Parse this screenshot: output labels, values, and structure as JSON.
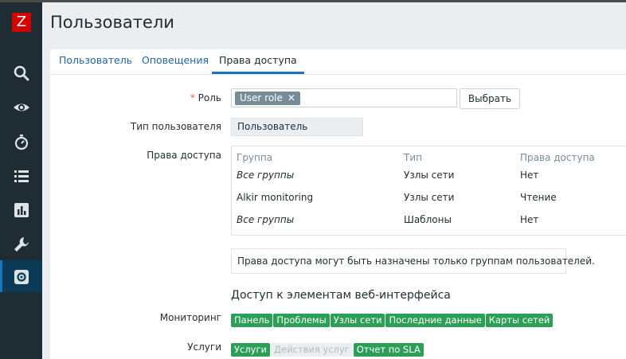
{
  "app": {
    "logo_letter": "Z"
  },
  "page": {
    "title": "Пользователи"
  },
  "sidebar": {
    "items": [
      {
        "icon": "search-icon"
      },
      {
        "icon": "eye-icon"
      },
      {
        "icon": "stopwatch-icon"
      },
      {
        "icon": "list-icon"
      },
      {
        "icon": "bar-chart-icon"
      },
      {
        "icon": "wrench-icon"
      },
      {
        "icon": "gear-icon",
        "active": true
      }
    ]
  },
  "tabs": [
    {
      "label": "Пользователь"
    },
    {
      "label": "Оповещения"
    },
    {
      "label": "Права доступа",
      "active": true
    }
  ],
  "form": {
    "role_label": "Роль",
    "role_required_mark": "*",
    "role_value": "User role",
    "role_remove": "✕",
    "select_button": "Выбрать",
    "user_type_label": "Тип пользователя",
    "user_type_value": "Пользователь",
    "permissions_label": "Права доступа",
    "permissions_table": {
      "headers": [
        "Группа",
        "Тип",
        "Права доступа"
      ],
      "rows": [
        {
          "group": "Все группы",
          "type": "Узлы сети",
          "access": "Нет",
          "italic": true
        },
        {
          "group": "Alkir monitoring",
          "type": "Узлы сети",
          "access": "Чтение",
          "italic": false
        },
        {
          "group": "Все группы",
          "type": "Шаблоны",
          "access": "Нет",
          "italic": true
        }
      ]
    },
    "permissions_note": "Права доступа могут быть назначены только группам пользователей.",
    "ui_access_title": "Доступ к элементам веб-интерфейса",
    "monitoring_label": "Мониторинг",
    "monitoring_items": [
      "Панель",
      "Проблемы",
      "Узлы сети",
      "Последние данные",
      "Карты сетей"
    ],
    "services_label": "Услуги",
    "services_items": [
      {
        "label": "Услуги",
        "enabled": true
      },
      {
        "label": "Действия услуг",
        "enabled": false
      },
      {
        "label": "Отчет по SLA",
        "enabled": true
      }
    ]
  },
  "colors": {
    "sidebar_bg": "#1f2c33",
    "accent": "#1d74bd",
    "logo": "#d40000",
    "chip_enabled": "#2a9f55",
    "chip_disabled": "#ebeef0"
  }
}
